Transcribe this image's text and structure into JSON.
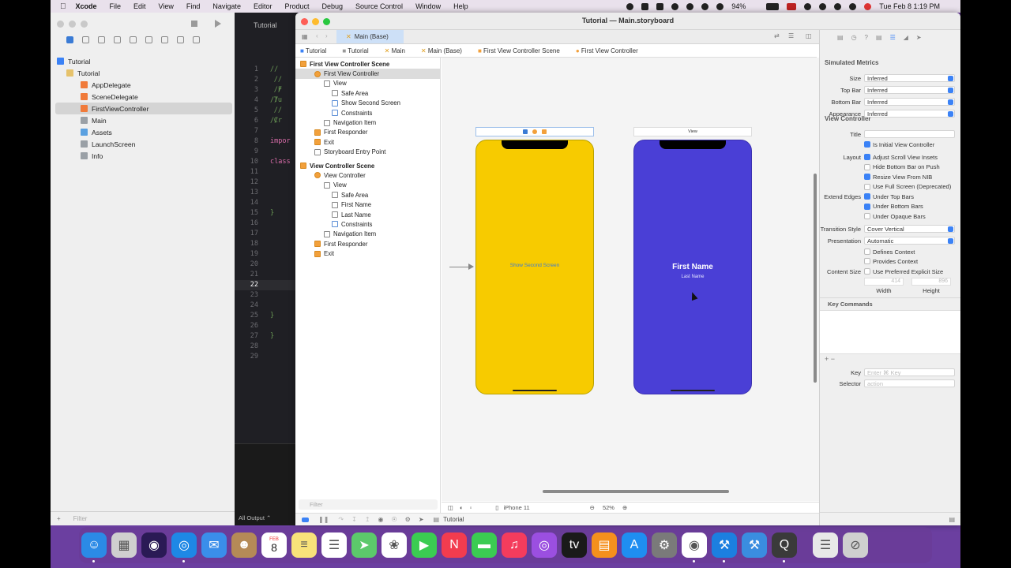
{
  "menubar": {
    "app": "Xcode",
    "items": [
      "File",
      "Edit",
      "View",
      "Find",
      "Navigate",
      "Editor",
      "Product",
      "Debug",
      "Source Control",
      "Window",
      "Help"
    ],
    "battery": "94%",
    "datetime": "Tue Feb 8  1:19 PM"
  },
  "navigator": {
    "items": [
      {
        "label": "Tutorial",
        "indent": 8,
        "color": "#3b82f6"
      },
      {
        "label": "Tutorial",
        "indent": 20,
        "color": "#e6c26b"
      },
      {
        "label": "AppDelegate",
        "indent": 38,
        "color": "#f07a3a"
      },
      {
        "label": "SceneDelegate",
        "indent": 38,
        "color": "#f07a3a"
      },
      {
        "label": "FirstViewController",
        "indent": 38,
        "color": "#f07a3a",
        "selected": true
      },
      {
        "label": "Main",
        "indent": 38,
        "color": "#9aa0a6"
      },
      {
        "label": "Assets",
        "indent": 38,
        "color": "#5aa0e0"
      },
      {
        "label": "LaunchScreen",
        "indent": 38,
        "color": "#9aa0a6"
      },
      {
        "label": "Info",
        "indent": 38,
        "color": "#9aa0a6"
      }
    ],
    "filter_placeholder": "Filter"
  },
  "editor": {
    "tab": "Tutorial",
    "lines": [
      {
        "n": "1",
        "t": "//"
      },
      {
        "n": "2",
        "t": "//  F"
      },
      {
        "n": "3",
        "t": "//  Tu"
      },
      {
        "n": "4",
        "t": "//"
      },
      {
        "n": "5",
        "t": "//  Cr"
      },
      {
        "n": "6",
        "t": "//"
      },
      {
        "n": "7",
        "t": ""
      },
      {
        "n": "8",
        "t": "impor",
        "kw": true
      },
      {
        "n": "9",
        "t": ""
      },
      {
        "n": "10",
        "t": "class",
        "kw": true
      },
      {
        "n": "11",
        "t": ""
      },
      {
        "n": "12",
        "t": ""
      },
      {
        "n": "13",
        "t": ""
      },
      {
        "n": "14",
        "t": ""
      },
      {
        "n": "15",
        "t": "}"
      },
      {
        "n": "16",
        "t": ""
      },
      {
        "n": "17",
        "t": ""
      },
      {
        "n": "18",
        "t": ""
      },
      {
        "n": "19",
        "t": ""
      },
      {
        "n": "20",
        "t": ""
      },
      {
        "n": "21",
        "t": ""
      },
      {
        "n": "22",
        "t": "",
        "cur": true
      },
      {
        "n": "23",
        "t": ""
      },
      {
        "n": "24",
        "t": ""
      },
      {
        "n": "25",
        "t": "}"
      },
      {
        "n": "26",
        "t": ""
      },
      {
        "n": "27",
        "t": "}"
      },
      {
        "n": "28",
        "t": ""
      },
      {
        "n": "29",
        "t": ""
      }
    ],
    "output_label": "All Output ⌃"
  },
  "window": {
    "title": "Tutorial — Main.storyboard",
    "tab": "Main (Base)",
    "jumpbar": [
      "Tutorial",
      "Tutorial",
      "Main",
      "Main (Base)",
      "First View Controller Scene",
      "First View Controller"
    ]
  },
  "outline": [
    {
      "label": "First View Controller Scene",
      "indent": 6,
      "head": true,
      "icon": "o"
    },
    {
      "label": "First View Controller",
      "indent": 24,
      "icon": "y",
      "selected": true
    },
    {
      "label": "View",
      "indent": 36,
      "icon": "w"
    },
    {
      "label": "Safe Area",
      "indent": 46,
      "icon": "w"
    },
    {
      "label": "Show Second Screen",
      "indent": 46,
      "icon": "b"
    },
    {
      "label": "Constraints",
      "indent": 46,
      "icon": "b"
    },
    {
      "label": "Navigation Item",
      "indent": 36,
      "icon": "w"
    },
    {
      "label": "First Responder",
      "indent": 24,
      "icon": "o"
    },
    {
      "label": "Exit",
      "indent": 24,
      "icon": "o"
    },
    {
      "label": "Storyboard Entry Point",
      "indent": 24,
      "icon": "w"
    },
    {
      "label": "View Controller Scene",
      "indent": 6,
      "head": true,
      "icon": "o"
    },
    {
      "label": "View Controller",
      "indent": 24,
      "icon": "y"
    },
    {
      "label": "View",
      "indent": 36,
      "icon": "w"
    },
    {
      "label": "Safe Area",
      "indent": 46,
      "icon": "w"
    },
    {
      "label": "First Name",
      "indent": 46,
      "icon": "w"
    },
    {
      "label": "Last Name",
      "indent": 46,
      "icon": "w"
    },
    {
      "label": "Constraints",
      "indent": 46,
      "icon": "b"
    },
    {
      "label": "Navigation Item",
      "indent": 36,
      "icon": "w"
    },
    {
      "label": "First Responder",
      "indent": 24,
      "icon": "o"
    },
    {
      "label": "Exit",
      "indent": 24,
      "icon": "o"
    }
  ],
  "outline_filter": "Filter",
  "canvas": {
    "button_label": "Show Second Screen",
    "first_name": "First Name",
    "last_name": "Last Name",
    "vc2_header": "View",
    "yellow": "#f7cb00",
    "purple": "#4a3fd6"
  },
  "bottombar": {
    "device": "iPhone 11",
    "zoom": "52%"
  },
  "debugbar": {
    "target": "Tutorial"
  },
  "inspector": {
    "simulated_metrics": "Simulated Metrics",
    "metrics": [
      {
        "label": "Size",
        "value": "Inferred"
      },
      {
        "label": "Top Bar",
        "value": "Inferred"
      },
      {
        "label": "Bottom Bar",
        "value": "Inferred"
      },
      {
        "label": "Appearance",
        "value": "Inferred"
      }
    ],
    "view_controller": "View Controller",
    "title_label": "Title",
    "is_initial": "Is Initial View Controller",
    "layout_label": "Layout",
    "layout_opts": [
      {
        "label": "Adjust Scroll View Insets",
        "on": true
      },
      {
        "label": "Hide Bottom Bar on Push",
        "on": false
      },
      {
        "label": "Resize View From NIB",
        "on": true
      },
      {
        "label": "Use Full Screen (Deprecated)",
        "on": false
      }
    ],
    "extend_label": "Extend Edges",
    "extend_opts": [
      {
        "label": "Under Top Bars",
        "on": true
      },
      {
        "label": "Under Bottom Bars",
        "on": true
      },
      {
        "label": "Under Opaque Bars",
        "on": false
      }
    ],
    "transition_label": "Transition Style",
    "transition_value": "Cover Vertical",
    "presentation_label": "Presentation",
    "presentation_value": "Automatic",
    "defines_context": "Defines Context",
    "provides_context": "Provides Context",
    "content_size_label": "Content Size",
    "use_preferred": "Use Preferred Explicit Size",
    "width_value": "414",
    "height_value": "896",
    "width_label": "Width",
    "height_label": "Height",
    "key_commands": "Key Commands",
    "key_label": "Key",
    "key_placeholder": "Enter ⌘ Key",
    "selector_label": "Selector",
    "selector_placeholder": "action"
  },
  "dock": [
    {
      "name": "finder-icon",
      "color": "#2b8ae6",
      "glyph": "☺"
    },
    {
      "name": "launchpad-icon",
      "color": "#cfcfcf",
      "glyph": "▦"
    },
    {
      "name": "siri-icon",
      "color": "#2a1a55",
      "glyph": "◉"
    },
    {
      "name": "safari-icon",
      "color": "#1e88e5",
      "glyph": "◎"
    },
    {
      "name": "mail-icon",
      "color": "#3a8eea",
      "glyph": "✉"
    },
    {
      "name": "contacts-icon",
      "color": "#b58a57",
      "glyph": "☻"
    },
    {
      "name": "calendar-icon",
      "color": "#ffffff",
      "glyph": ""
    },
    {
      "name": "notes-icon",
      "color": "#f8e27a",
      "glyph": "≡"
    },
    {
      "name": "reminders-icon",
      "color": "#ffffff",
      "glyph": "☰"
    },
    {
      "name": "maps-icon",
      "color": "#5cc96b",
      "glyph": "➤"
    },
    {
      "name": "photos-icon",
      "color": "#ffffff",
      "glyph": "❀"
    },
    {
      "name": "facetime-icon",
      "color": "#3bcc52",
      "glyph": "▶"
    },
    {
      "name": "news-icon",
      "color": "#f23c4f",
      "glyph": "N"
    },
    {
      "name": "messages-icon",
      "color": "#3bcc52",
      "glyph": "▬"
    },
    {
      "name": "music-icon",
      "color": "#f43c5d",
      "glyph": "♫"
    },
    {
      "name": "podcasts-icon",
      "color": "#9b4fe0",
      "glyph": "◎"
    },
    {
      "name": "tv-icon",
      "color": "#1a1a1a",
      "glyph": "tv"
    },
    {
      "name": "books-icon",
      "color": "#f5901d",
      "glyph": "▤"
    },
    {
      "name": "app-store-icon",
      "color": "#1f8ef1",
      "glyph": "A"
    },
    {
      "name": "system-preferences-icon",
      "color": "#7a7a7a",
      "glyph": "⚙"
    },
    {
      "name": "chrome-icon",
      "color": "#ffffff",
      "glyph": "◉"
    },
    {
      "name": "xcode-icon",
      "color": "#1c7fe0",
      "glyph": "⚒"
    },
    {
      "name": "simulator-icon",
      "color": "#3a8de0",
      "glyph": "⚒"
    },
    {
      "name": "quicktime-icon",
      "color": "#3a3a3a",
      "glyph": "Q"
    },
    {
      "name": "document-icon",
      "color": "#e8e8e8",
      "glyph": "☰"
    },
    {
      "name": "trash-icon",
      "color": "#cfcfcf",
      "glyph": "⊘"
    }
  ],
  "calendar_badge": {
    "month": "FEB",
    "day": "8"
  }
}
